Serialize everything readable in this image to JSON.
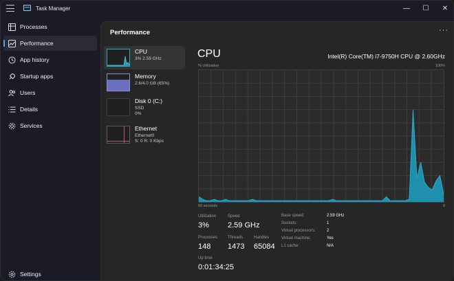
{
  "app": {
    "title": "Task Manager"
  },
  "window_controls": {
    "minimize": "—",
    "maximize": "☐",
    "close": "✕"
  },
  "sidebar": {
    "items": [
      {
        "label": "Processes",
        "icon": "processes-icon"
      },
      {
        "label": "Performance",
        "icon": "performance-icon",
        "active": true
      },
      {
        "label": "App history",
        "icon": "history-icon"
      },
      {
        "label": "Startup apps",
        "icon": "startup-icon"
      },
      {
        "label": "Users",
        "icon": "users-icon"
      },
      {
        "label": "Details",
        "icon": "details-icon"
      },
      {
        "label": "Services",
        "icon": "services-icon"
      }
    ],
    "settings_label": "Settings"
  },
  "panel": {
    "title": "Performance",
    "more": "···"
  },
  "devices": [
    {
      "name": "CPU",
      "line1": "3%  2.59 GHz",
      "active": true
    },
    {
      "name": "Memory",
      "line1": "2.6/4.0 GB (65%)"
    },
    {
      "name": "Disk 0 (C:)",
      "line1": "SSD",
      "line2": "0%"
    },
    {
      "name": "Ethernet",
      "line1": "Ethernet0",
      "line2": "S: 0  R: 0 Kbps"
    }
  ],
  "detail": {
    "title": "CPU",
    "model": "Intel(R) Core(TM) i7-9750H CPU @ 2.60GHz",
    "graph": {
      "y_label": "% Utilization",
      "y_max_label": "100%",
      "x_left_label": "60 seconds",
      "x_right_label": "0",
      "series": [
        4,
        2,
        1,
        1,
        2,
        1,
        1,
        2,
        1,
        1,
        1,
        1,
        1,
        1,
        2,
        1,
        1,
        1,
        1,
        1,
        1,
        1,
        1,
        1,
        1,
        1,
        1,
        1,
        1,
        1,
        1,
        1,
        1,
        1,
        1,
        2,
        1,
        1,
        1,
        1,
        1,
        1,
        1,
        1,
        1,
        1,
        1,
        1,
        1,
        4,
        1,
        1,
        1,
        1,
        1,
        2,
        70,
        18,
        30,
        15,
        11,
        9,
        16,
        20,
        6
      ]
    },
    "stats": {
      "utilization": {
        "label": "Utilization",
        "value": "3%"
      },
      "speed": {
        "label": "Speed",
        "value": "2.59 GHz"
      },
      "processes": {
        "label": "Processes",
        "value": "148"
      },
      "threads": {
        "label": "Threads",
        "value": "1473"
      },
      "handles": {
        "label": "Handles",
        "value": "65084"
      },
      "uptime": {
        "label": "Up time",
        "value": "0:01:34:25"
      }
    },
    "specs": [
      {
        "label": "Base speed:",
        "value": "2.59 GHz"
      },
      {
        "label": "Sockets:",
        "value": "1"
      },
      {
        "label": "Virtual processors:",
        "value": "2"
      },
      {
        "label": "Virtual machine:",
        "value": "Yes"
      },
      {
        "label": "L1 cache:",
        "value": "N/A"
      }
    ]
  },
  "colors": {
    "cpu_stroke": "#2ea8c9",
    "cpu_fill": "#1f95b5",
    "memory_fill": "#6a6fc0",
    "ethernet_line": "#c05878"
  }
}
